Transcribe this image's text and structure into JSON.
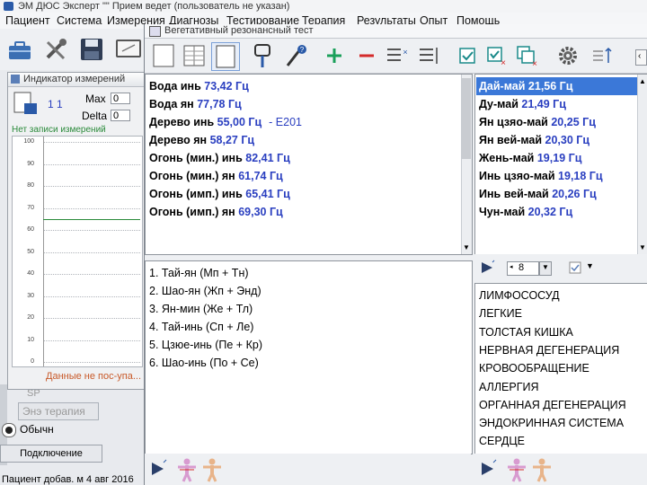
{
  "main_window": {
    "title": "ЭМ ДЮС Эксперт  \"\" Прием ведет (пользователь не указан)",
    "menu": [
      "Пациент",
      "Система",
      "Измерения",
      "Диагнозы",
      "Тестирование",
      "Терапия",
      "Результаты",
      "Опыт",
      "Помощь"
    ]
  },
  "indicator_window": {
    "title": "Индикатор измерений",
    "max_label": "Max",
    "max_value": "0",
    "delta_label": "Delta",
    "delta_value": "0",
    "counter": "1 1",
    "no_records": "Нет записи измерений",
    "footer_text": "Данные не пос-упа...",
    "y_ticks": [
      "100",
      "90",
      "80",
      "70",
      "60",
      "50",
      "40",
      "30",
      "20",
      "10",
      "0"
    ]
  },
  "left_panel": {
    "sp_label": "SP",
    "therapy_label": "Энэ терапия",
    "mode_label": "Обычн",
    "connect_button": "Подключение",
    "status_text": "Пациент добав. м 4 авг 2016"
  },
  "resonance_window": {
    "title": "Вегетативный резонансный тест",
    "frequencies": [
      {
        "name": "Вода инь",
        "value": "73,42 Гц",
        "extra": ""
      },
      {
        "name": "Вода ян",
        "value": "77,78 Гц",
        "extra": ""
      },
      {
        "name": "Дерево инь",
        "value": "55,00 Гц",
        "extra": "-   E201"
      },
      {
        "name": "Дерево ян",
        "value": "58,27 Гц",
        "extra": ""
      },
      {
        "name": "Огонь (мин.) инь",
        "value": "82,41 Гц",
        "extra": ""
      },
      {
        "name": "Огонь (мин.) ян",
        "value": "61,74 Гц",
        "extra": ""
      },
      {
        "name": "Огонь (имп.) инь",
        "value": "65,41 Гц",
        "extra": ""
      },
      {
        "name": "Огонь (имп.) ян",
        "value": "69,30 Гц",
        "extra": ""
      }
    ],
    "meridians": [
      {
        "name": "Дай-май",
        "value": "21,56 Гц",
        "selected": true
      },
      {
        "name": "Ду-май",
        "value": "21,49 Гц",
        "selected": false
      },
      {
        "name": "Ян цзяо-май",
        "value": "20,25 Гц",
        "selected": false
      },
      {
        "name": "Ян вей-май",
        "value": "20,30 Гц",
        "selected": false
      },
      {
        "name": "Жень-май",
        "value": "19,19 Гц",
        "selected": false
      },
      {
        "name": "Инь цзяо-май",
        "value": "19,18 Гц",
        "selected": false
      },
      {
        "name": "Инь вей-май",
        "value": "20,26 Гц",
        "selected": false
      },
      {
        "name": "Чун-май",
        "value": "20,32 Гц",
        "selected": false
      }
    ],
    "spinner_value": "8",
    "channels": [
      "1. Тай-ян (Мп + Тн)",
      "2. Шао-ян (Жп + Энд)",
      "3. Ян-мин (Же + Тл)",
      "4. Тай-инь (Сп + Ле)",
      "5. Цзюе-инь (Пе + Кр)",
      "6. Шао-инь (По + Се)"
    ],
    "systems": [
      "ЛИМФОСОСУД",
      "ЛЕГКИЕ",
      "ТОЛСТАЯ КИШКА",
      "НЕРВНАЯ ДЕГЕНЕРАЦИЯ",
      "КРОВООБРАЩЕНИЕ",
      "АЛЛЕРГИЯ",
      "ОРГАННАЯ ДЕГЕНЕРАЦИЯ",
      "ЭНДОКРИННАЯ СИСТЕМА",
      "СЕРДЦЕ"
    ]
  },
  "colors": {
    "accent_blue": "#2a3fc0",
    "selection": "#3b78d8",
    "add_green": "#1aa05a",
    "remove_red": "#d42a2a",
    "no_records_green": "#2a8a3a",
    "body_figure": "#d89bd0"
  },
  "icons": [
    "briefcase-icon",
    "tools-icon",
    "save-icon",
    "monitor-icon",
    "blank-page-icon",
    "table-icon",
    "page-icon",
    "probe-icon",
    "pipette-icon",
    "plus-icon",
    "minus-icon",
    "list-add-icon",
    "list-remove-icon",
    "check-icon",
    "check-remove-icon",
    "copy-check-icon",
    "gear-icon",
    "sort-icon",
    "play-icon",
    "body-front-icon",
    "body-back-icon"
  ]
}
